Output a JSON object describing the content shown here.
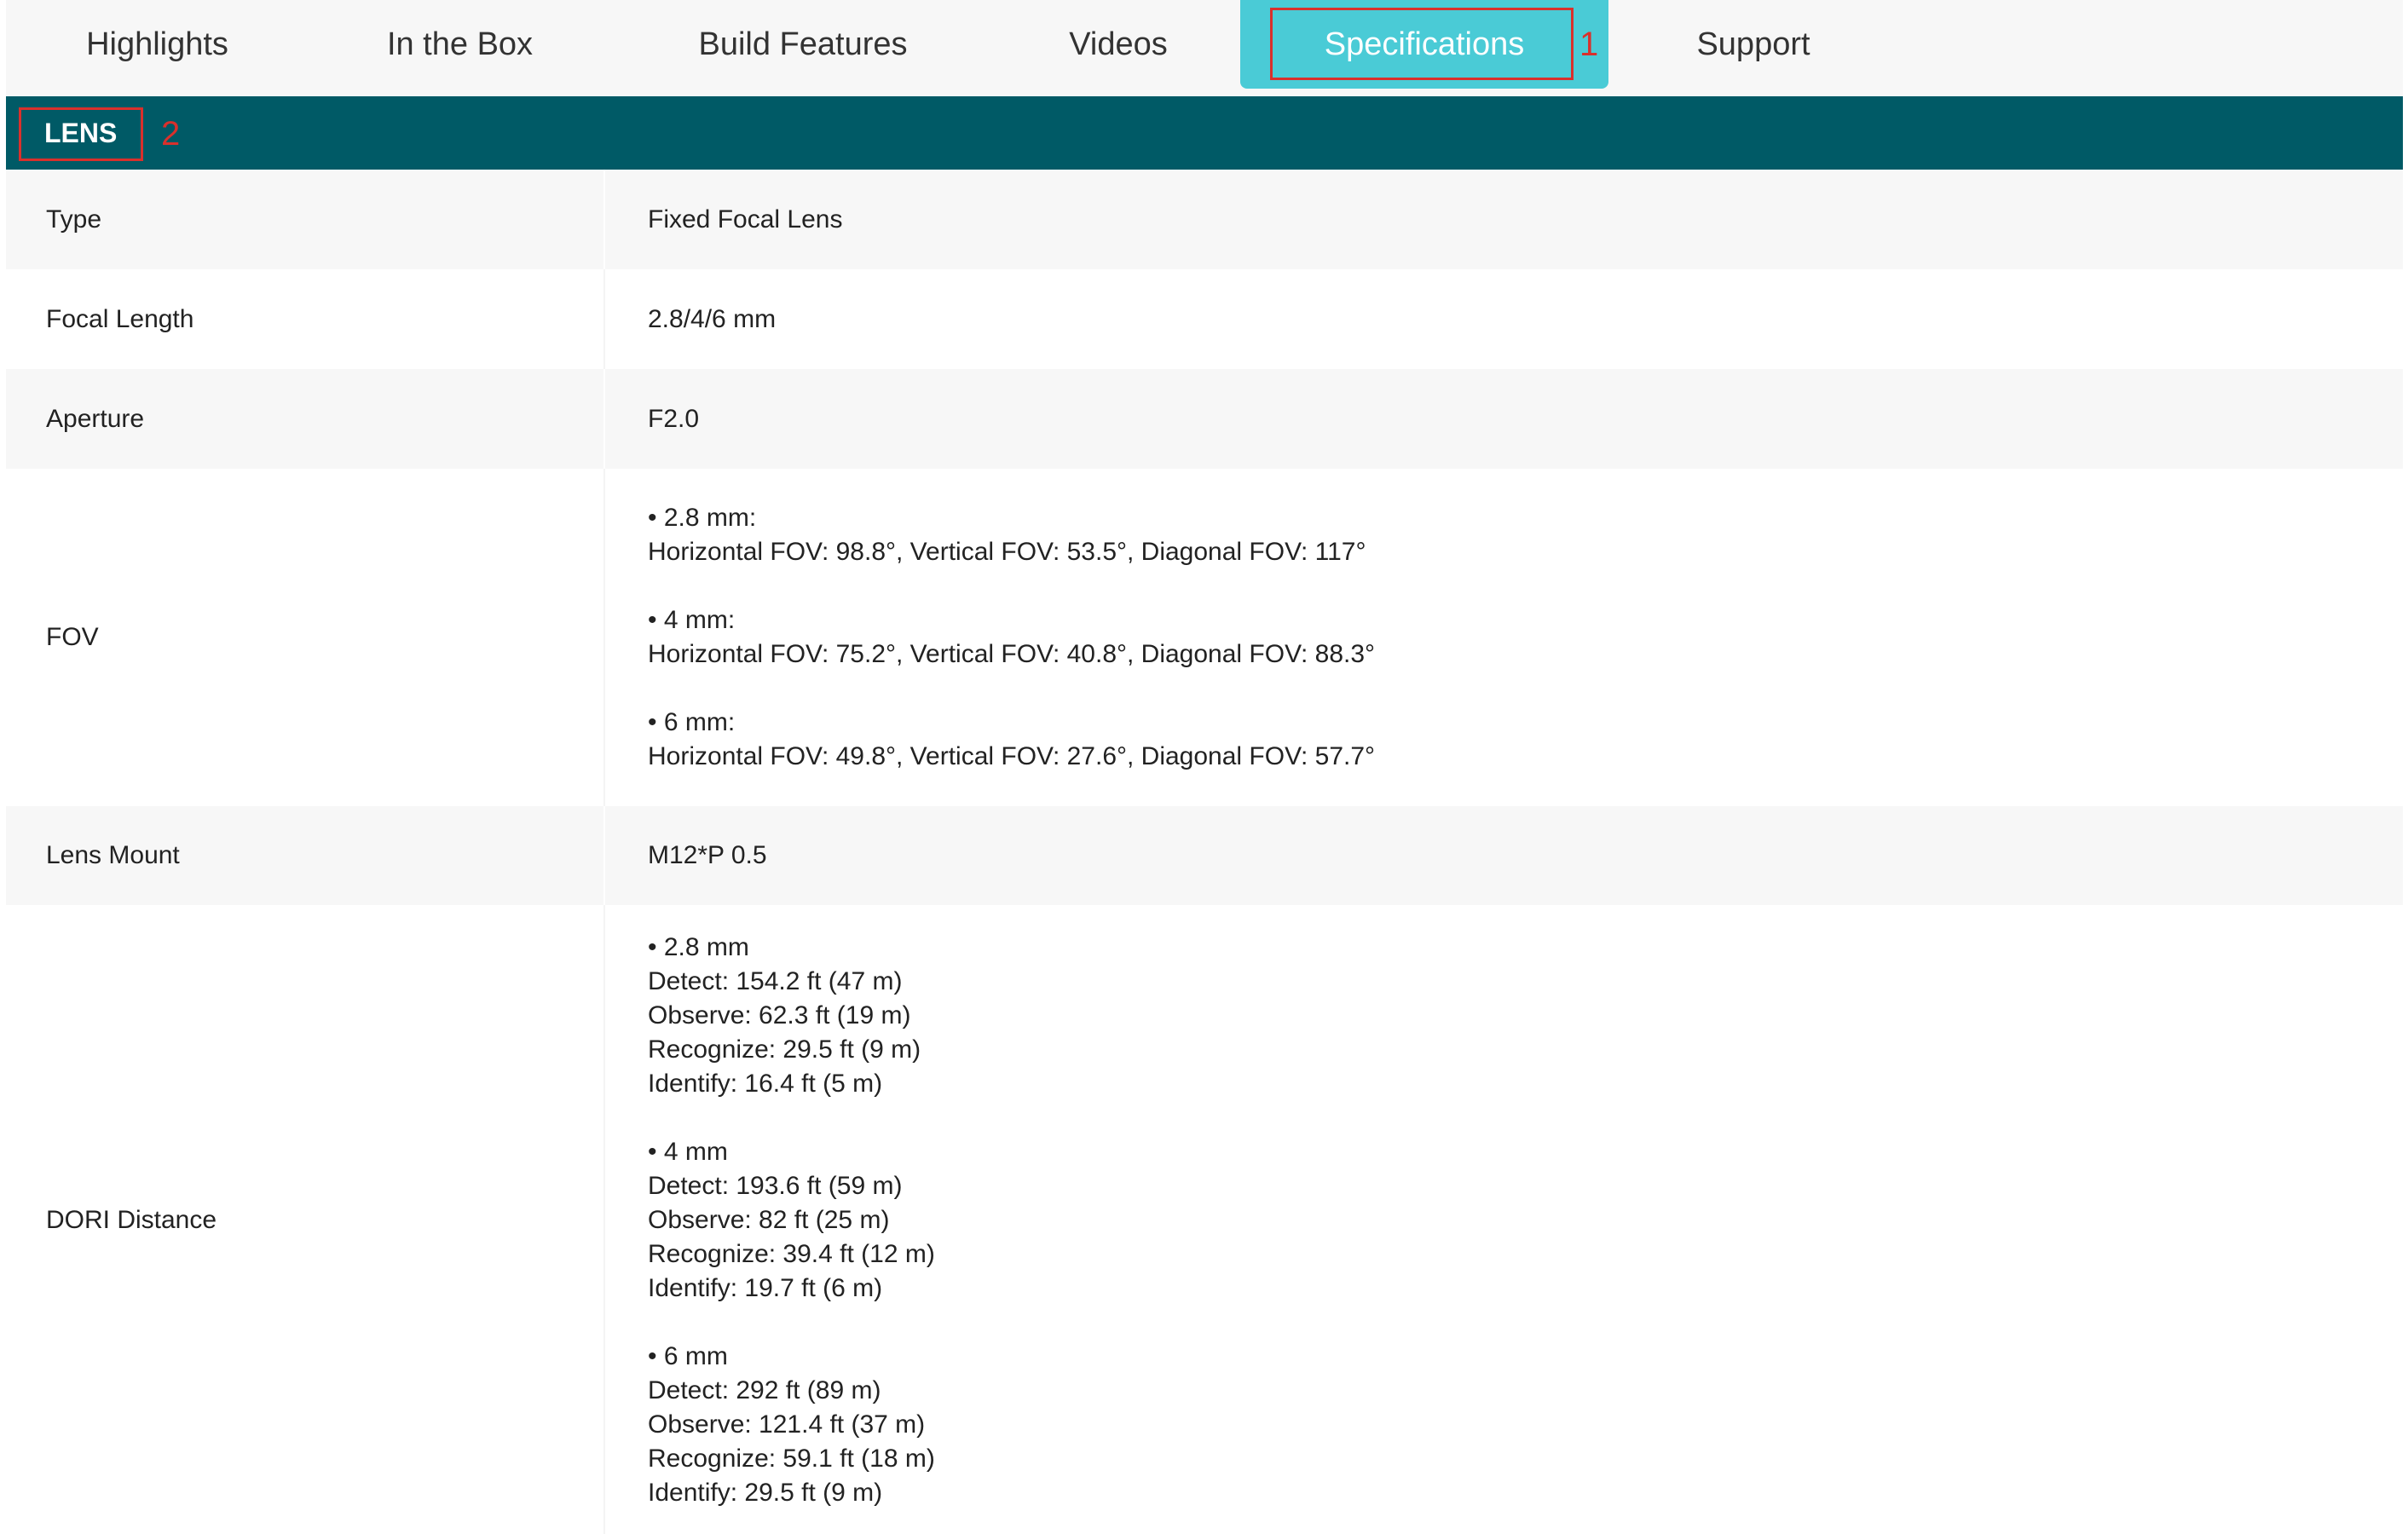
{
  "tabs": [
    {
      "label": "Highlights"
    },
    {
      "label": "In the Box"
    },
    {
      "label": "Build Features"
    },
    {
      "label": "Videos"
    },
    {
      "label": "Specifications",
      "active": true
    },
    {
      "label": "Support"
    }
  ],
  "annotations": {
    "tab_marker": "1",
    "section_marker": "2"
  },
  "section": {
    "title": "LENS"
  },
  "specs": [
    {
      "key": "Type",
      "lines": [
        "Fixed Focal Lens"
      ]
    },
    {
      "key": "Focal Length",
      "lines": [
        "2.8/4/6 mm"
      ]
    },
    {
      "key": "Aperture",
      "lines": [
        "F2.0"
      ]
    },
    {
      "key": "FOV",
      "lines": [
        "• 2.8 mm:",
        "Horizontal FOV: 98.8°, Vertical FOV: 53.5°, Diagonal FOV: 117°",
        "",
        "• 4 mm:",
        "Horizontal FOV: 75.2°, Vertical FOV: 40.8°, Diagonal FOV: 88.3°",
        "",
        "• 6 mm:",
        "Horizontal FOV: 49.8°, Vertical FOV: 27.6°, Diagonal FOV: 57.7°"
      ]
    },
    {
      "key": "Lens Mount",
      "lines": [
        "M12*P 0.5"
      ]
    },
    {
      "key": "DORI Distance",
      "lines": [
        "• 2.8 mm",
        "Detect: 154.2 ft (47 m)",
        "Observe: 62.3 ft (19 m)",
        "Recognize: 29.5 ft (9 m)",
        "Identify: 16.4 ft (5 m)",
        "",
        "• 4 mm",
        "Detect: 193.6 ft (59 m)",
        "Observe: 82 ft (25 m)",
        "Recognize: 39.4 ft (12 m)",
        "Identify: 19.7 ft (6 m)",
        "",
        "• 6 mm",
        "Detect: 292 ft (89 m)",
        "Observe: 121.4 ft (37 m)",
        "Recognize: 59.1 ft (18 m)",
        "Identify: 29.5 ft (9 m)"
      ]
    }
  ]
}
